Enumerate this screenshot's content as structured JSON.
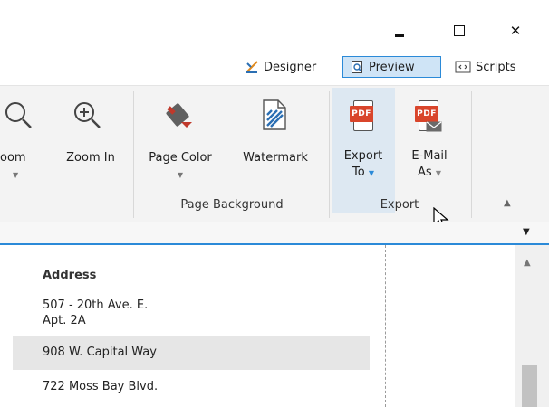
{
  "window": {
    "controls": {
      "minimize": "—",
      "maximize": "☐",
      "close": "✕"
    }
  },
  "view_switcher": {
    "designer": "Designer",
    "preview": "Preview",
    "scripts": "Scripts"
  },
  "ribbon": {
    "zoom_partial_label": "oom",
    "zoom_in_label": "Zoom In",
    "page_color_label": "Page Color",
    "watermark_label": "Watermark",
    "page_background_group": "Page Background",
    "export_to_line1": "Export",
    "export_to_line2": "To",
    "email_as_line1": "E-Mail",
    "email_as_line2": "As",
    "pdf_badge": "PDF",
    "export_group": "Export",
    "collapse_glyph": "▲",
    "dropdown_glyph": "▼"
  },
  "document": {
    "header": "Address",
    "rows": [
      "507 - 20th Ave. E.",
      "Apt. 2A",
      "908 W. Capital Way",
      "722 Moss Bay Blvd."
    ]
  },
  "colors": {
    "accent": "#2b8ad8",
    "pdf_red": "#d9452b",
    "ribbon_bg": "#f3f3f3",
    "highlight_row": "#e6e6e6"
  }
}
